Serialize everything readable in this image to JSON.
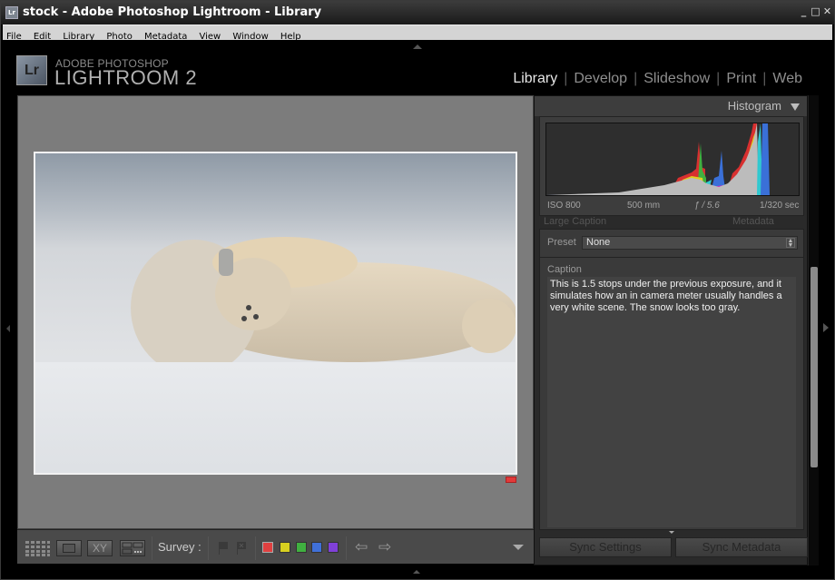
{
  "window": {
    "title": "stock - Adobe Photoshop Lightroom - Library",
    "app_icon_label": "Lr",
    "controls": {
      "minimize": "_",
      "maximize": "□",
      "close": "✕"
    }
  },
  "menu": [
    "File",
    "Edit",
    "Library",
    "Photo",
    "Metadata",
    "View",
    "Window",
    "Help"
  ],
  "identity": {
    "logo": "Lr",
    "line1": "ADOBE PHOTOSHOP",
    "line2": "LIGHTROOM 2"
  },
  "modules": [
    {
      "label": "Library",
      "active": true
    },
    {
      "label": "Develop",
      "active": false
    },
    {
      "label": "Slideshow",
      "active": false
    },
    {
      "label": "Print",
      "active": false
    },
    {
      "label": "Web",
      "active": false
    }
  ],
  "photo": {
    "subject": "Polar bear rolling in snow",
    "color_label": "red"
  },
  "toolbar": {
    "views": [
      "grid-view",
      "loupe-view",
      "compare-view",
      "survey-view"
    ],
    "compare_label": "XY",
    "survey_label": "Survey :",
    "color_labels": [
      "#e04040",
      "#d8d020",
      "#40b040",
      "#4070d8",
      "#8040d8"
    ],
    "prev_arrow": "⇦",
    "next_arrow": "⇨"
  },
  "histogram": {
    "title": "Histogram",
    "iso": "ISO 800",
    "focal_length": "500 mm",
    "aperture": "ƒ / 5.6",
    "shutter": "1/320 sec"
  },
  "metadata": {
    "ghost_left": "Large Caption",
    "ghost_right": "Metadata",
    "preset_label": "Preset",
    "preset_value": "None",
    "caption_label": "Caption",
    "caption_text": "This is 1.5 stops under the previous exposure, and it simulates how an in camera meter usually handles a very white scene. The snow looks too gray."
  },
  "buttons": {
    "sync_settings": "Sync Settings",
    "sync_metadata": "Sync Metadata"
  }
}
